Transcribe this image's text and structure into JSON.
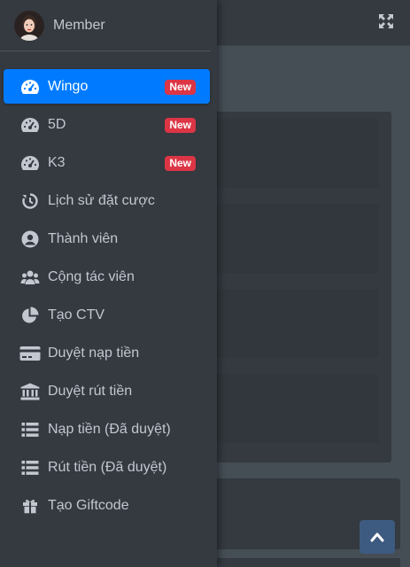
{
  "colors": {
    "sidebar_bg": "#343a40",
    "active_bg": "#007bff",
    "badge_bg": "#dc3545",
    "text": "#c2c7d0"
  },
  "user": {
    "name": "Member"
  },
  "nav": {
    "items": [
      {
        "label": "Wingo",
        "icon": "speedometer-icon",
        "badge": "New",
        "active": true
      },
      {
        "label": "5D",
        "icon": "speedometer-icon",
        "badge": "New"
      },
      {
        "label": "K3",
        "icon": "speedometer-icon",
        "badge": "New"
      },
      {
        "label": "Lịch sử đặt cược",
        "icon": "history-icon"
      },
      {
        "label": "Thành viên",
        "icon": "user-circle-icon"
      },
      {
        "label": "Cộng tác viên",
        "icon": "users-icon"
      },
      {
        "label": "Tạo CTV",
        "icon": "pie-chart-icon"
      },
      {
        "label": "Duyệt nạp tiền",
        "icon": "credit-card-icon"
      },
      {
        "label": "Duyệt rút tiền",
        "icon": "bank-icon"
      },
      {
        "label": "Nạp tiền (Đã duyệt)",
        "icon": "list-icon"
      },
      {
        "label": "Rút tiền (Đã duyệt)",
        "icon": "list-icon"
      },
      {
        "label": "Tạo Giftcode",
        "icon": "gift-icon"
      }
    ]
  }
}
